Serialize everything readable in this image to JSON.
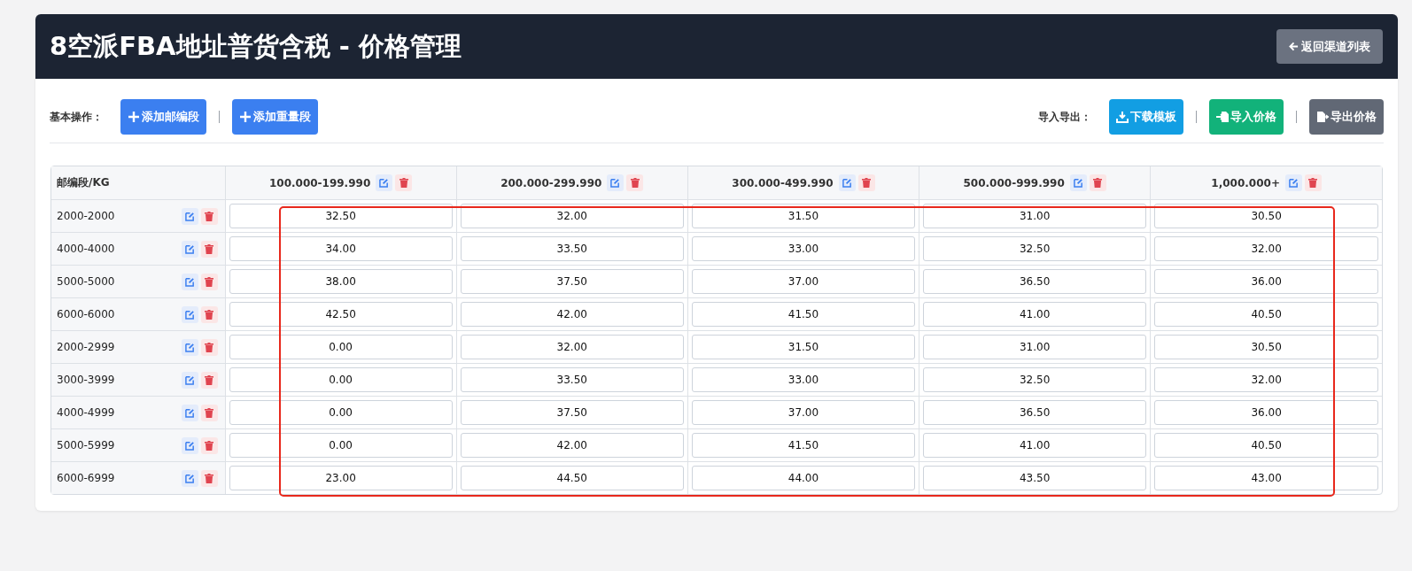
{
  "header": {
    "title": "8空派FBA地址普货含税 - 价格管理",
    "back_button": "返回渠道列表"
  },
  "toolbar": {
    "basic_label": "基本操作：",
    "basic_buttons": [
      {
        "label": "添加邮编段",
        "kind": "plus",
        "color": "#3b7ff0"
      },
      {
        "label": "添加重量段",
        "kind": "plus",
        "color": "#3b7ff0"
      }
    ],
    "io_label": "导入导出：",
    "io_buttons": [
      {
        "label": "下载模板",
        "kind": "download",
        "color": "#129ee3"
      },
      {
        "label": "导入价格",
        "kind": "import",
        "color": "#12b27a"
      },
      {
        "label": "导出价格",
        "kind": "export",
        "color": "#616875"
      }
    ]
  },
  "table": {
    "corner": "邮编段/KG",
    "columns": [
      "100.000-199.990",
      "200.000-299.990",
      "300.000-499.990",
      "500.000-999.990",
      "1,000.000+"
    ],
    "rows": [
      {
        "zone": "2000-2000",
        "prices": [
          "32.50",
          "32.00",
          "31.50",
          "31.00",
          "30.50"
        ]
      },
      {
        "zone": "4000-4000",
        "prices": [
          "34.00",
          "33.50",
          "33.00",
          "32.50",
          "32.00"
        ]
      },
      {
        "zone": "5000-5000",
        "prices": [
          "38.00",
          "37.50",
          "37.00",
          "36.50",
          "36.00"
        ]
      },
      {
        "zone": "6000-6000",
        "prices": [
          "42.50",
          "42.00",
          "41.50",
          "41.00",
          "40.50"
        ]
      },
      {
        "zone": "2000-2999",
        "prices": [
          "0.00",
          "32.00",
          "31.50",
          "31.00",
          "30.50"
        ]
      },
      {
        "zone": "3000-3999",
        "prices": [
          "0.00",
          "33.50",
          "33.00",
          "32.50",
          "32.00"
        ]
      },
      {
        "zone": "4000-4999",
        "prices": [
          "0.00",
          "37.50",
          "37.00",
          "36.50",
          "36.00"
        ]
      },
      {
        "zone": "5000-5999",
        "prices": [
          "0.00",
          "42.00",
          "41.50",
          "41.00",
          "40.50"
        ]
      },
      {
        "zone": "6000-6999",
        "prices": [
          "23.00",
          "44.50",
          "44.00",
          "43.50",
          "43.00"
        ]
      }
    ]
  }
}
